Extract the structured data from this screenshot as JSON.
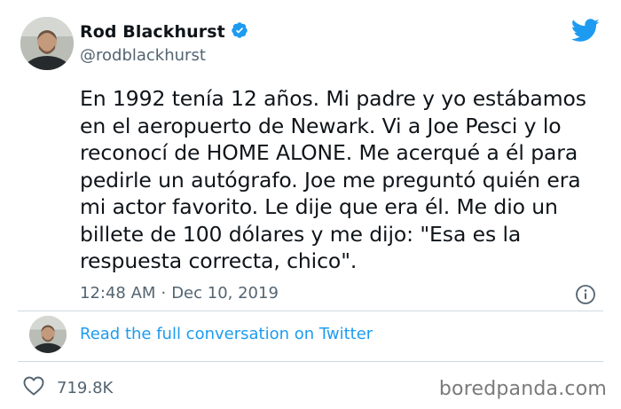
{
  "author": {
    "display_name": "Rod Blackhurst",
    "handle": "@rodblackhurst",
    "verified": true
  },
  "tweet": {
    "text": "En 1992 tenía 12 años. Mi padre y yo estábamos\nen el aeropuerto de Newark. Vi a Joe Pesci y lo\nreconocí de HOME ALONE. Me acerqué a él para\npedirle un autógrafo. Joe me preguntó quién era\nmi actor favorito. Le dije que era él. Me dio un\nbillete de 100 dólares y me dijo: \"Esa es la\nrespuesta correcta, chico\".",
    "time": "12:48 AM",
    "separator": "·",
    "date": "Dec 10, 2019"
  },
  "conversation_link": "Read the full conversation on Twitter",
  "likes_count": "719.8K",
  "watermark": "boredpanda.com",
  "colors": {
    "accent": "#1d9bf0",
    "secondary_text": "#536471",
    "primary_text": "#0f1419"
  },
  "icons": {
    "verified": "verified-badge-icon",
    "logo": "twitter-bird-icon",
    "info": "info-icon",
    "like": "heart-icon"
  }
}
